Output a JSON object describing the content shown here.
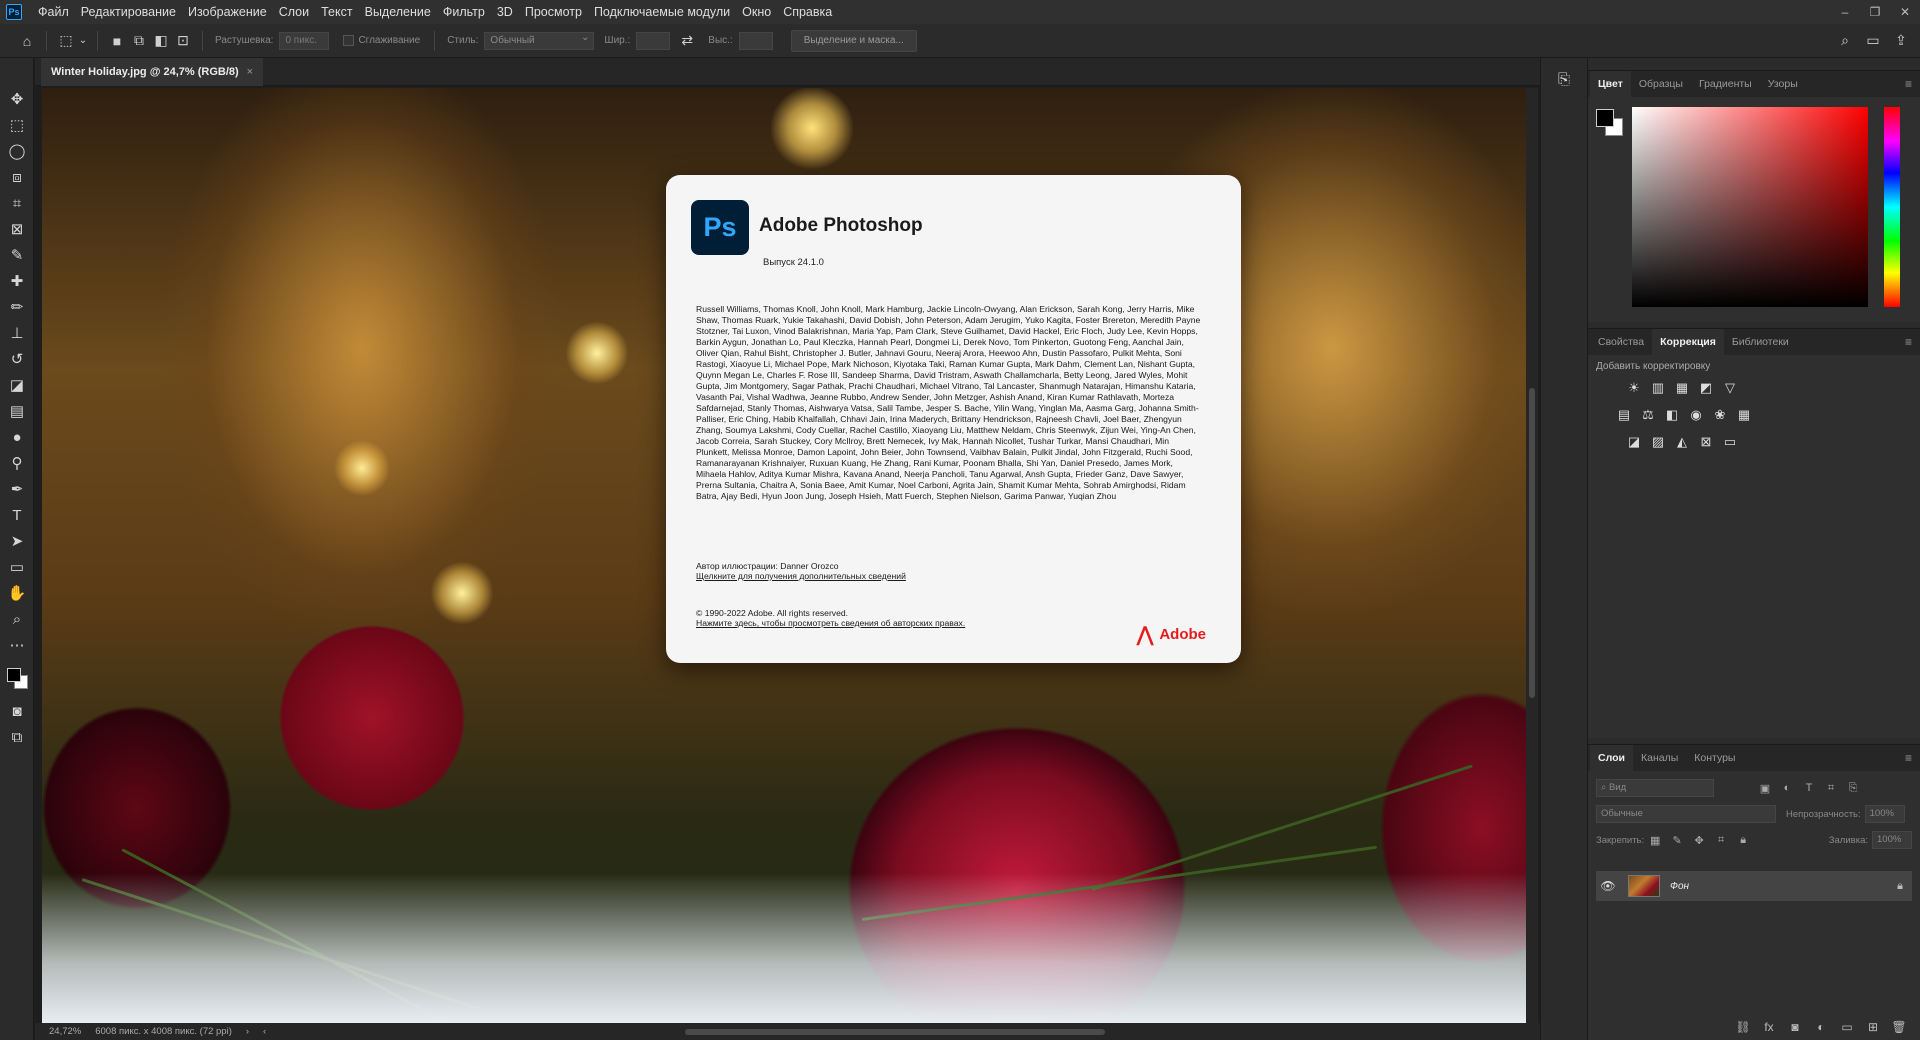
{
  "app": {
    "logo": "Ps",
    "menu": [
      "Файл",
      "Редактирование",
      "Изображение",
      "Слои",
      "Текст",
      "Выделение",
      "Фильтр",
      "3D",
      "Просмотр",
      "Подключаемые модули",
      "Окно",
      "Справка"
    ]
  },
  "options": {
    "feather_label": "Растушевка:",
    "feather_value": "0 пикс.",
    "antialias_label": "Сглаживание",
    "style_label": "Стиль:",
    "style_value": "Обычный",
    "width_label": "Шир.:",
    "height_label": "Выс.:",
    "select_mask_button": "Выделение и маска..."
  },
  "document": {
    "tab_title": "Winter Holiday.jpg @ 24,7% (RGB/8)",
    "tab_close": "×"
  },
  "status": {
    "zoom": "24,72%",
    "size": "6008 пикс. x 4008 пикс. (72 ppi)"
  },
  "about": {
    "badge": "Ps",
    "title": "Adobe Photoshop",
    "version": "Выпуск 24.1.0",
    "credits": "Russell Williams, Thomas Knoll, John Knoll, Mark Hamburg, Jackie Lincoln-Owyang, Alan Erickson, Sarah Kong, Jerry Harris, Mike Shaw, Thomas Ruark, Yukie Takahashi, David Dobish, John Peterson, Adam Jerugim, Yuko Kagita, Foster Brereton, Meredith Payne Stotzner, Tai Luxon, Vinod Balakrishnan, Maria Yap, Pam Clark, Steve Guilhamet, David Hackel, Eric Floch, Judy Lee, Kevin Hopps, Barkin Aygun, Jonathan Lo, Paul Kleczka, Hannah Pearl, Dongmei Li, Derek Novo, Tom Pinkerton, Guotong Feng, Aanchal Jain, Oliver Qian, Rahul Bisht, Christopher J. Butler, Jahnavi Gouru, Neeraj Arora, Heewoo Ahn, Dustin Passofaro, Pulkit Mehta, Soni Rastogi, Xiaoyue Li, Michael Pope, Mark Nichoson, Kiyotaka Taki, Raman Kumar Gupta, Mark Dahm, Clement Lan, Nishant Gupta, Quynn Megan Le, Charles F. Rose III, Sandeep Sharma, David Tristram, Aswath Challamcharla, Betty Leong, Jared Wyles, Mohit Gupta, Jim Montgomery, Sagar Pathak, Prachi Chaudhari, Michael Vitrano, Tal Lancaster, Shanmugh Natarajan, Himanshu Kataria, Vasanth Pai, Vishal Wadhwa, Jeanne Rubbo, Andrew Sender, John Metzger, Ashish Anand, Kiran Kumar Rathlavath, Morteza Safdarnejad, Stanly Thomas, Aishwarya Vatsa, Salil Tambe, Jesper S. Bache, Yilin Wang, Yinglan Ma, Aasma Garg, Johanna Smith-Palliser, Eric Ching, Habib Khalfallah, Chhavi Jain, Irina Maderych, Brittany Hendrickson, Rajneesh Chavli, Joel Baer, Zhengyun Zhang, Soumya Lakshmi, Cody Cuellar, Rachel Castillo, Xiaoyang Liu, Matthew Neldam, Chris Steenwyk, Zijun Wei, Ying-An Chen, Jacob Correia, Sarah Stuckey, Cory McIlroy, Brett Nemecek, Ivy Mak, Hannah Nicollet, Tushar Turkar, Mansi Chaudhari, Min Plunkett, Melissa Monroe, Damon Lapoint, John Beier, John Townsend, Vaibhav Balain, Pulkit Jindal, John Fitzgerald, Ruchi Sood, Ramanarayanan Krishnaiyer, Ruxuan Kuang, He Zhang, Rani Kumar, Poonam Bhalla, Shi Yan, Daniel Presedo, James Mork, Mihaela Hahlov, Aditya Kumar Mishra, Kavana Anand, Neerja Pancholi, Tanu Agarwal, Ansh Gupta, Frieder Ganz, Dave Sawyer, Prerna Sultania, Chaitra A, Sonia Baee, Amit Kumar, Noel Carboni, Agrita Jain, Shamit Kumar Mehta, Sohrab Amirghodsi, Ridam Batra, Ajay Bedi, Hyun Joon Jung, Joseph Hsieh, Matt Fuerch, Stephen Nielson, Garima Panwar, Yuqian Zhou",
    "illustration": "Автор иллюстрации: Danner Orozco",
    "illustration_link": "Щелкните для получения дополнительных сведений",
    "copyright": "© 1990-2022 Adobe. All rights reserved.",
    "copyright_link": "Нажмите здесь, чтобы просмотреть сведения об авторских правах.",
    "adobe": "Adobe"
  },
  "color_panel": {
    "tabs": [
      "Цвет",
      "Образцы",
      "Градиенты",
      "Узоры"
    ],
    "active": 0
  },
  "adjust_panel": {
    "tabs": [
      "Свойства",
      "Коррекция",
      "Библиотеки"
    ],
    "active": 1,
    "label": "Добавить корректировку"
  },
  "layers_panel": {
    "tabs": [
      "Слои",
      "Каналы",
      "Контуры"
    ],
    "active": 0,
    "search_placeholder": "Вид",
    "blend_mode": "Обычные",
    "opacity_label": "Непрозрачность:",
    "opacity": "100%",
    "lock_label": "Закрепить:",
    "fill_label": "Заливка:",
    "fill": "100%",
    "layers": [
      {
        "name": "Фон",
        "locked": true,
        "visible": true
      }
    ]
  }
}
